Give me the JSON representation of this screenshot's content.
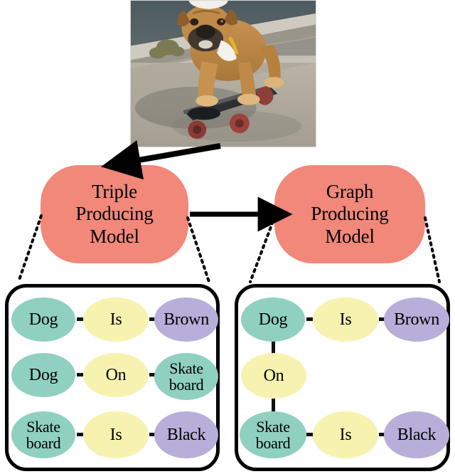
{
  "figure": {
    "photo": {
      "alt_description": "Brown bulldog standing on a black skateboard on a concrete sidewalk",
      "subject": "Dog",
      "object": "Skateboard",
      "dog_color": "Brown",
      "skateboard_color": "Black"
    },
    "models": {
      "triple": {
        "line1": "Triple",
        "line2": "Producing",
        "line3": "Model"
      },
      "graph": {
        "line1": "Graph",
        "line2": "Producing",
        "line3": "Model"
      }
    },
    "panels": {
      "triples": {
        "rows": [
          {
            "subject": "Dog",
            "predicate": "Is",
            "object": "Brown"
          },
          {
            "subject": "Dog",
            "predicate": "On",
            "object": "Skate\nboard"
          },
          {
            "subject": "Skate\nboard",
            "predicate": "Is",
            "object": "Black"
          }
        ]
      },
      "graph": {
        "nodes": [
          {
            "id": "dog",
            "label": "Dog",
            "kind": "entity"
          },
          {
            "id": "is1",
            "label": "Is",
            "kind": "predicate"
          },
          {
            "id": "brown",
            "label": "Brown",
            "kind": "attribute"
          },
          {
            "id": "on",
            "label": "On",
            "kind": "predicate"
          },
          {
            "id": "skateboard",
            "label": "Skate\nboard",
            "kind": "entity"
          },
          {
            "id": "is2",
            "label": "Is",
            "kind": "predicate"
          },
          {
            "id": "black",
            "label": "Black",
            "kind": "attribute"
          }
        ],
        "edges": [
          {
            "from": "dog",
            "to": "is1"
          },
          {
            "from": "is1",
            "to": "brown"
          },
          {
            "from": "dog",
            "to": "on"
          },
          {
            "from": "on",
            "to": "skateboard"
          },
          {
            "from": "skateboard",
            "to": "is2"
          },
          {
            "from": "is2",
            "to": "black"
          }
        ]
      }
    },
    "colors": {
      "model_box": "#f1887a",
      "entity": "#8fd0c1",
      "predicate": "#f7f2b0",
      "attribute": "#b7afd9",
      "stroke": "#000000"
    }
  }
}
